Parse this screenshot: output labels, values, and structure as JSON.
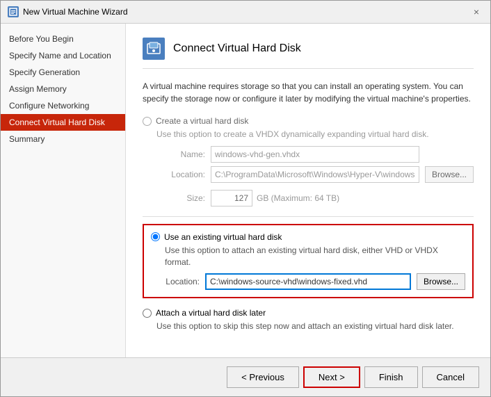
{
  "window": {
    "title": "New Virtual Machine Wizard",
    "close_label": "×"
  },
  "sidebar": {
    "items": [
      {
        "id": "before-you-begin",
        "label": "Before You Begin",
        "active": false
      },
      {
        "id": "specify-name",
        "label": "Specify Name and Location",
        "active": false
      },
      {
        "id": "specify-generation",
        "label": "Specify Generation",
        "active": false
      },
      {
        "id": "assign-memory",
        "label": "Assign Memory",
        "active": false
      },
      {
        "id": "configure-networking",
        "label": "Configure Networking",
        "active": false
      },
      {
        "id": "connect-vhd",
        "label": "Connect Virtual Hard Disk",
        "active": true
      },
      {
        "id": "summary",
        "label": "Summary",
        "active": false
      }
    ]
  },
  "main": {
    "header_icon": "💾",
    "header_title": "Connect Virtual Hard Disk",
    "description": "A virtual machine requires storage so that you can install an operating system. You can specify the storage now or configure it later by modifying the virtual machine's properties.",
    "option_create": {
      "label": "Create a virtual hard disk",
      "description": "Use this option to create a VHDX dynamically expanding virtual hard disk.",
      "name_label": "Name:",
      "name_value": "windows-vhd-gen.vhdx",
      "location_label": "Location:",
      "location_value": "C:\\ProgramData\\Microsoft\\Windows\\Hyper-V\\windows-vhd-gen\\Vir",
      "size_label": "Size:",
      "size_value": "127",
      "size_unit": "GB (Maximum: 64 TB)",
      "browse_label": "Browse..."
    },
    "option_existing": {
      "label": "Use an existing virtual hard disk",
      "description": "Use this option to attach an existing virtual hard disk, either VHD or VHDX format.",
      "location_label": "Location:",
      "location_value": "C:\\windows-source-vhd\\windows-fixed.vhd",
      "browse_label": "Browse..."
    },
    "option_attach_later": {
      "label": "Attach a virtual hard disk later",
      "description": "Use this option to skip this step now and attach an existing virtual hard disk later."
    }
  },
  "footer": {
    "previous_label": "< Previous",
    "next_label": "Next >",
    "finish_label": "Finish",
    "cancel_label": "Cancel"
  }
}
